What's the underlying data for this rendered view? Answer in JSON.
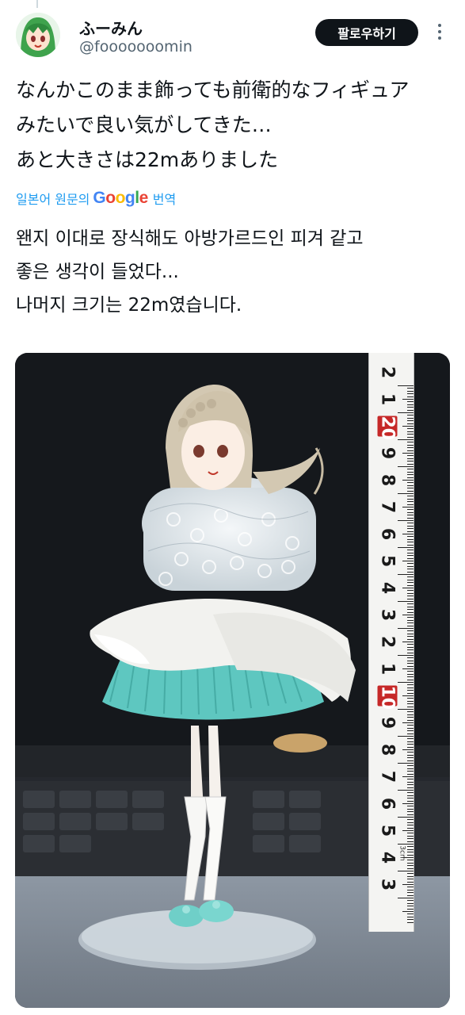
{
  "user": {
    "display_name": "ふーみん",
    "handle": "@fooooooomin",
    "avatar": "green-haired-anime-avatar"
  },
  "follow_button_label": "팔로우하기",
  "tweet": {
    "lines": [
      "なんかこのまま飾っても前衛的なフィギュア",
      "みたいで良い気がしてきた…",
      "あと大きさは22mありました"
    ]
  },
  "translation": {
    "prefix": "일본어 원문의",
    "google_logo": "Google",
    "suffix": "번역",
    "lines": [
      "왠지 이대로 장식해도 아방가르드인 피겨 같고",
      "좋은 생각이 들었다...",
      "나머지 크기는 22m였습니다."
    ]
  },
  "photo": {
    "subject": "figure-wrapped-in-bubble-wrap-with-ruler",
    "ruler_numbers": [
      "2",
      "1",
      "20",
      "9",
      "8",
      "7",
      "6",
      "5",
      "4",
      "3",
      "2",
      "1",
      "10",
      "9",
      "8",
      "7",
      "6",
      "5",
      "4",
      "3"
    ],
    "ruler_small_label": "3cm",
    "colors": {
      "skirt_teal": "#5ec7c0",
      "skirt_white": "#f2f2ef",
      "bubble_wrap": "#dfe6ea",
      "ruler_highlight": "#c62828"
    }
  }
}
